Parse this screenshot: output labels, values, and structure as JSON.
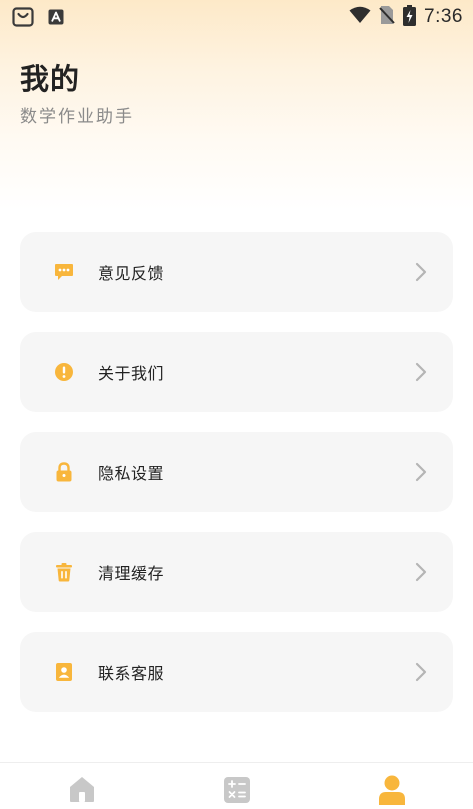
{
  "status_bar": {
    "time": "7:36",
    "left_icons": [
      "shopping-bag-icon",
      "app-a-icon"
    ],
    "right_icons": [
      "wifi-icon",
      "no-sim-icon",
      "battery-charging-icon"
    ]
  },
  "header": {
    "title": "我的",
    "subtitle": "数学作业助手"
  },
  "menu": {
    "items": [
      {
        "label": "意见反馈",
        "icon": "feedback-icon"
      },
      {
        "label": "关于我们",
        "icon": "info-icon"
      },
      {
        "label": "隐私设置",
        "icon": "lock-icon"
      },
      {
        "label": "清理缓存",
        "icon": "trash-icon"
      },
      {
        "label": "联系客服",
        "icon": "contact-icon"
      }
    ]
  },
  "bottom_nav": {
    "items": [
      {
        "icon": "home-icon",
        "active": false
      },
      {
        "icon": "calculator-icon",
        "active": false
      },
      {
        "icon": "profile-icon",
        "active": true
      }
    ]
  },
  "colors": {
    "accent": "#f8b63c",
    "inactive_nav": "#c8c8c8",
    "card_bg": "#f6f6f6"
  }
}
